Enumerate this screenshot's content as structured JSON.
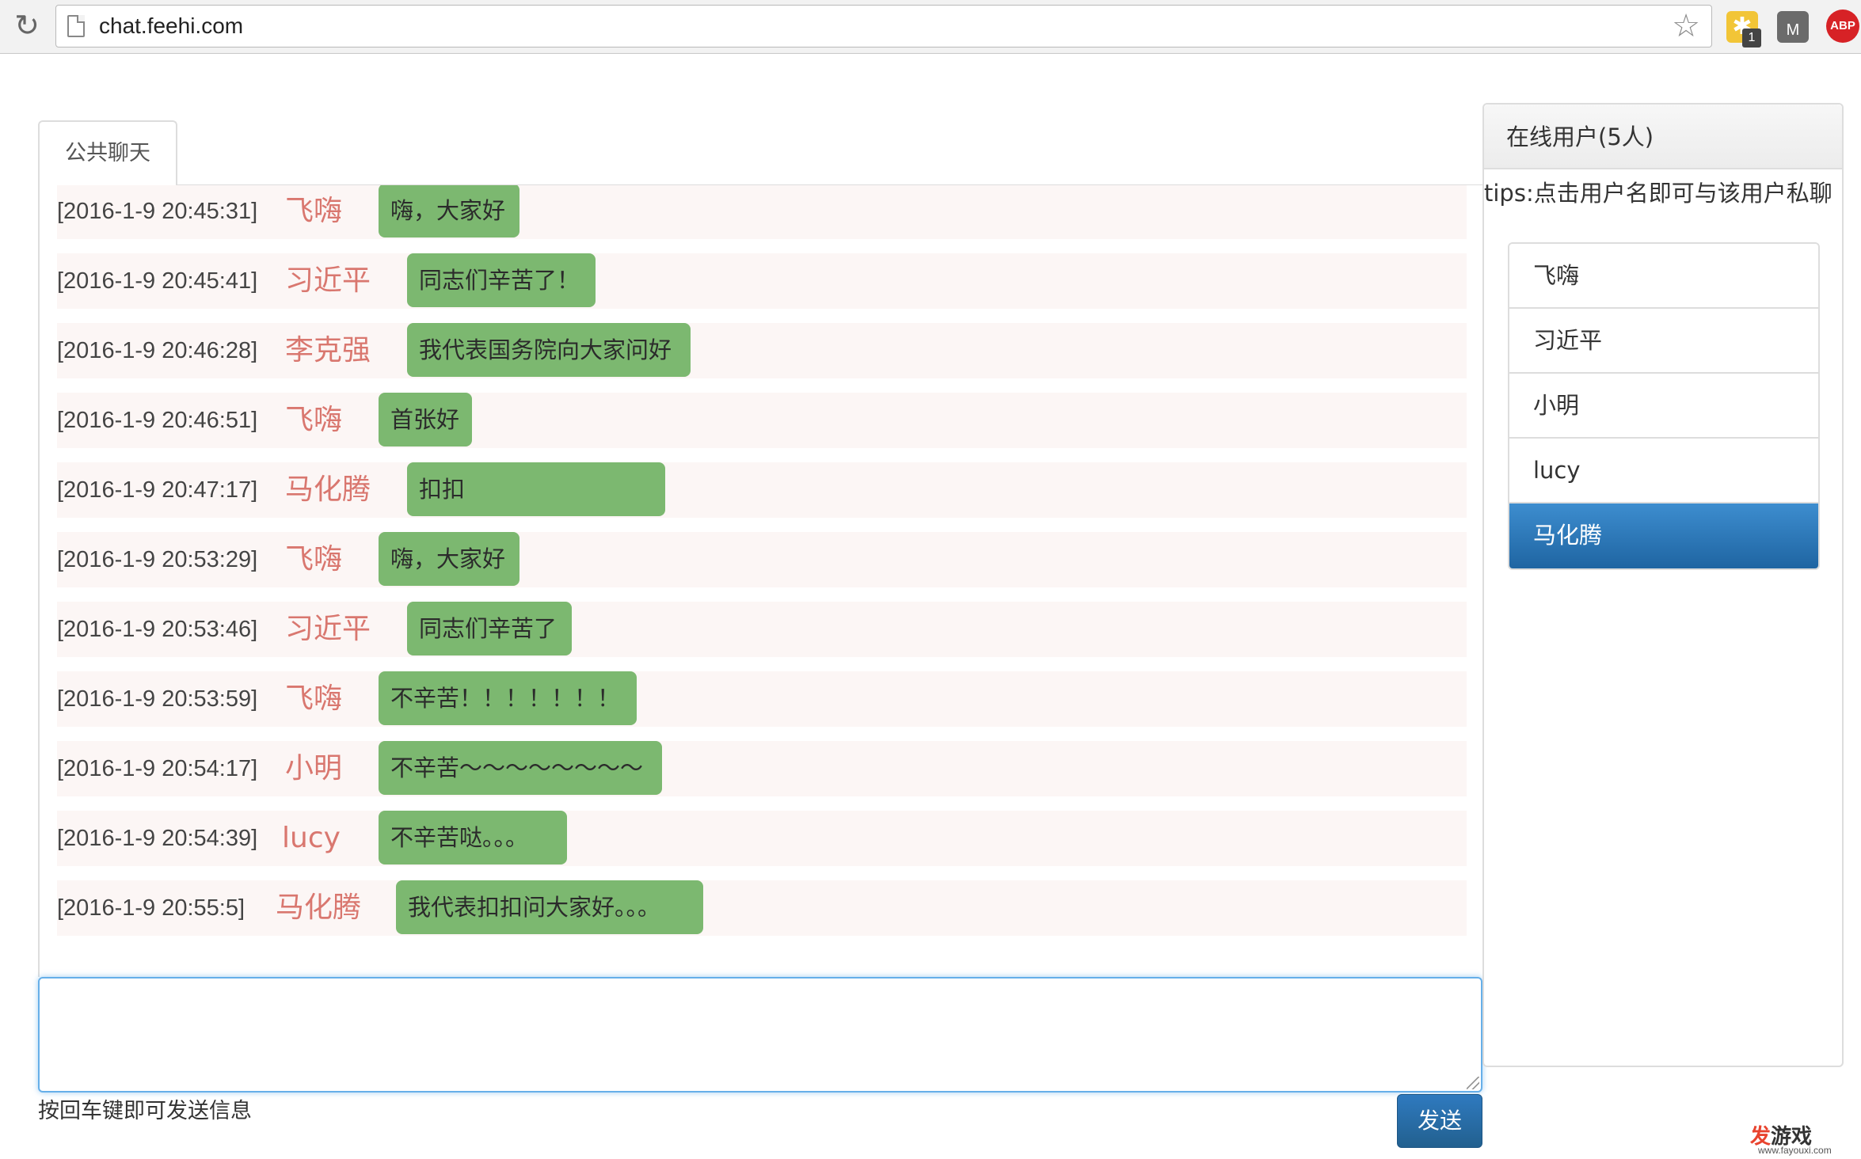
{
  "browser": {
    "url": "chat.feehi.com",
    "extension_badge": "1",
    "ext_m_label": "M",
    "ext_abp_label": "ABP",
    "icons": [
      "reload-icon",
      "page-icon",
      "star-icon",
      "puzzle-extension-icon",
      "m-extension-icon",
      "abp-icon"
    ]
  },
  "chat": {
    "tab_label": "公共聊天",
    "messages": [
      {
        "time": "",
        "user": "",
        "text": ""
      },
      {
        "time": "[2016-1-9 20:45:31]",
        "user": "飞嗨",
        "text": "嗨，大家好"
      },
      {
        "time": "[2016-1-9 20:45:41]",
        "user": "习近平",
        "text": "同志们辛苦了！"
      },
      {
        "time": "[2016-1-9 20:46:28]",
        "user": "李克强",
        "text": "我代表国务院向大家问好"
      },
      {
        "time": "[2016-1-9 20:46:51]",
        "user": "飞嗨",
        "text": "首张好"
      },
      {
        "time": "[2016-1-9 20:47:17]",
        "user": "马化腾",
        "text": "扣扣"
      },
      {
        "time": "[2016-1-9 20:53:29]",
        "user": "飞嗨",
        "text": "嗨，大家好"
      },
      {
        "time": "[2016-1-9 20:53:46]",
        "user": "习近平",
        "text": "同志们辛苦了"
      },
      {
        "time": "[2016-1-9 20:53:59]",
        "user": "飞嗨",
        "text": "不辛苦！！！！！！！"
      },
      {
        "time": "[2016-1-9 20:54:17]",
        "user": "小明",
        "text": "不辛苦～～～～～～～～"
      },
      {
        "time": "[2016-1-9 20:54:39]",
        "user": "lucy",
        "text": "不辛苦哒。。。"
      },
      {
        "time": "[2016-1-9 20:55:5]",
        "user": "马化腾",
        "text": "我代表扣扣问大家好。。。"
      }
    ],
    "input_value": "",
    "hint": "按回车键即可发送信息",
    "send_label": "发送"
  },
  "users": {
    "header": "在线用户(5人)",
    "tips": "tips:点击用户名即可与该用户私聊",
    "list": [
      {
        "name": "飞嗨",
        "active": false
      },
      {
        "name": "习近平",
        "active": false
      },
      {
        "name": "小明",
        "active": false
      },
      {
        "name": "lucy",
        "active": false
      },
      {
        "name": "马化腾",
        "active": true
      }
    ],
    "active_color": "#2f7abf"
  },
  "watermark": {
    "brand_first": "发",
    "brand_rest": "游戏",
    "url": "www.fayouxi.com"
  }
}
